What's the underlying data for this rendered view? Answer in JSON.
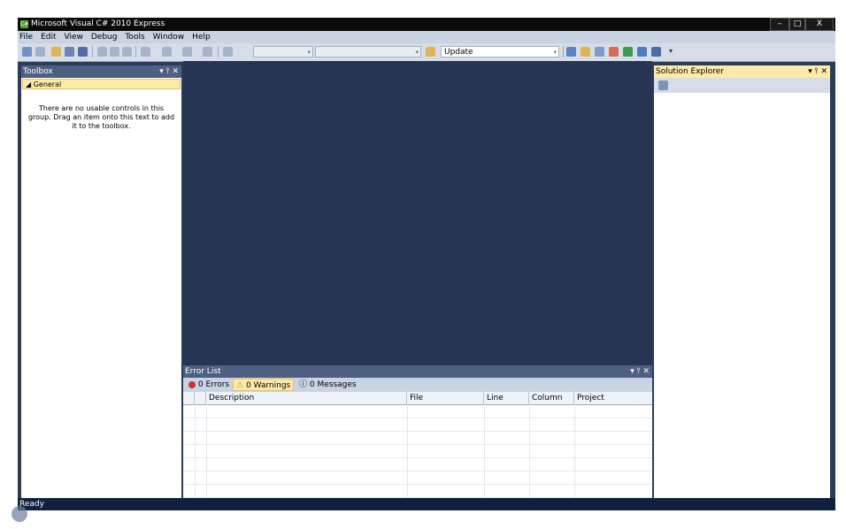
{
  "window": {
    "title": "Microsoft Visual C# 2010 Express",
    "app_icon": "C#",
    "controls": [
      "–",
      "□",
      "X"
    ]
  },
  "menu": [
    "File",
    "Edit",
    "View",
    "Debug",
    "Tools",
    "Window",
    "Help"
  ],
  "toolbar": {
    "config_combo": "",
    "platform_combo": "",
    "find_combo": "Update"
  },
  "toolbox": {
    "title": "Toolbox",
    "controls": "▾ ⫯ ✕",
    "group": "◢ General",
    "message": "There are no usable controls in this group. Drag an item onto this text to add it to the toolbox."
  },
  "error_list": {
    "title": "Error List",
    "controls": "▾ ⫯ ✕",
    "filters": {
      "errors": "0 Errors",
      "warnings": "0 Warnings",
      "messages": "0 Messages"
    },
    "columns": [
      "Description",
      "File",
      "Line",
      "Column",
      "Project"
    ]
  },
  "solution_explorer": {
    "title": "Solution Explorer",
    "controls": "▾ ⫯ ✕"
  },
  "status": "Ready",
  "colors": {
    "chrome": "#2b3c59",
    "panel_title": "#4d6082",
    "highlight": "#fde9a8"
  }
}
